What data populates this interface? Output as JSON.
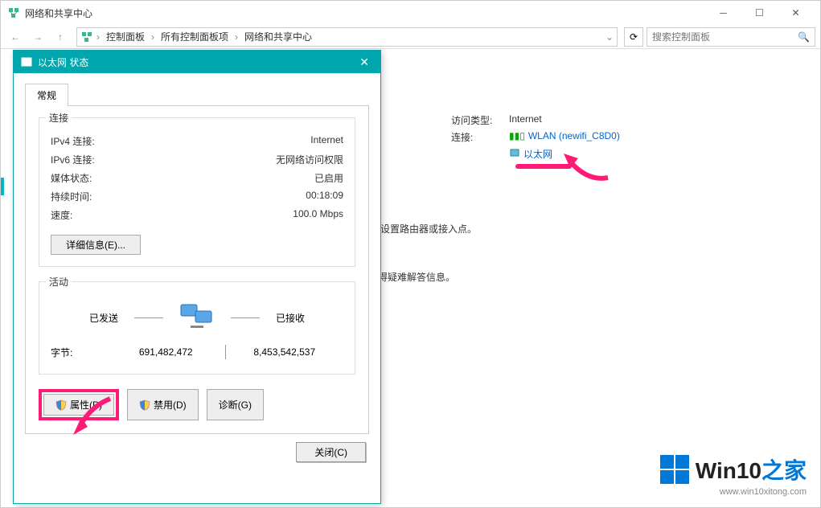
{
  "window": {
    "title": "网络和共享中心",
    "breadcrumbs": [
      "控制面板",
      "所有控制面板项",
      "网络和共享中心"
    ],
    "search_placeholder": "搜索控制面板"
  },
  "network_info": {
    "access_type_label": "访问类型:",
    "access_type_value": "Internet",
    "connections_label": "连接:",
    "wlan_label": "WLAN (newifi_C8D0)",
    "ethernet_label": "以太网"
  },
  "hints": {
    "line1": "或设置路由器或接入点。",
    "line2": "获得疑难解答信息。"
  },
  "dialog": {
    "title": "以太网 状态",
    "tab": "常规",
    "connection_group": "连接",
    "ipv4_label": "IPv4 连接:",
    "ipv4_value": "Internet",
    "ipv6_label": "IPv6 连接:",
    "ipv6_value": "无网络访问权限",
    "media_label": "媒体状态:",
    "media_value": "已启用",
    "duration_label": "持续时间:",
    "duration_value": "00:18:09",
    "speed_label": "速度:",
    "speed_value": "100.0 Mbps",
    "details_btn": "详细信息(E)...",
    "activity_group": "活动",
    "sent_label": "已发送",
    "received_label": "已接收",
    "bytes_label": "字节:",
    "bytes_sent": "691,482,472",
    "bytes_received": "8,453,542,537",
    "properties_btn": "属性(P)",
    "disable_btn": "禁用(D)",
    "diagnose_btn": "诊断(G)",
    "close_btn": "关闭(C)"
  },
  "logo": {
    "text_main": "Win10",
    "text_suffix": "之家",
    "url": "www.win10xitong.com"
  }
}
